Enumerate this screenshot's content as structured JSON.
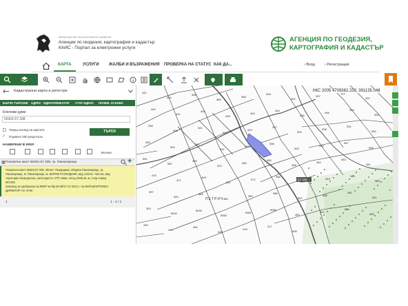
{
  "header": {
    "left_lines": [
      "Министерство на регионалното развитие",
      "Агенция по геодезия, картография и кадастър",
      "КАИС - Портал за електронни услуги"
    ],
    "right_lines": [
      "АГЕНЦИЯ ПО ГЕОДЕЗИЯ,",
      "КАРТОГРАФИЯ И КАДАСТЪР"
    ]
  },
  "nav": {
    "items": [
      "КАРТА",
      "УСЛУГИ",
      "ЖАЛБИ И ВЪЗРАЖЕНИЯ",
      "ПРОВЕРКА НА СТАТУС",
      "КАК ДА..."
    ],
    "login": "Вход",
    "register": "Регистрация"
  },
  "map": {
    "coord": "ККС 2005 4709382.239, 391135.046",
    "labels": [
      "331",
      "394",
      "396",
      "389",
      "395",
      "318",
      "391",
      "397",
      "333",
      "402",
      "440",
      "441",
      "442",
      "445",
      "443",
      "444",
      "446",
      "448",
      "449",
      "390",
      "338",
      "326",
      "321",
      "312",
      "319",
      "337",
      "329",
      "328",
      "331",
      "530",
      "535",
      "534",
      "531",
      "532",
      "539",
      "538",
      "533",
      "543",
      "547",
      "548",
      "551",
      "552",
      "329",
      "322",
      "456",
      "455",
      "458",
      "452",
      "353",
      "451",
      "476",
      "471",
      "493",
      "361",
      "372",
      "366",
      "347",
      "349",
      "344",
      "365",
      "357",
      "393",
      "364",
      "360",
      "363",
      "388",
      "367",
      "348",
      "340",
      "341",
      "343",
      "5042",
      "5040",
      "5063",
      "5061",
      "5064",
      "480",
      "422",
      "500",
      "452",
      "439",
      "449",
      "484",
      "409",
      "418",
      "417",
      "406"
    ],
    "mark": "57.338",
    "street": "ПЕТРИЧ"
  },
  "panel": {
    "title": "Кадастрална карта и регистри",
    "tabs": [
      "БЪРЗО ТЪРСЕНЕ",
      "АДРЕС",
      "ИДЕНТИФИКАТОР",
      "СТАР ИДЕНТ.",
      "ПОЗЕМ. ОСНОВА"
    ],
    "key_label": "Ключови думи",
    "key_value": "55302.57.338",
    "check1": "Текущ изглед на картата",
    "check2": "Първите 200 резултата",
    "search_btn": "ТЪРСИ",
    "found_header": "НАМЕРЕНИ В КККР",
    "all_label": "Всички",
    "result_header": "Поземлен имот 55302.57.338, гр. Панагюрище",
    "result_lines": [
      "Поземлен имот 55302.57.338, област Пазарджик, община Панагюрище, гр.",
      "Панагюрище, м. Панагюрище, м. БОРОВ РАЗХОДНИК, вид собств. Частна, вид",
      "територия Земеделска, категория 8, НТП Нива, площ 2946 кв. м, стар номер",
      "057338",
      "Заповед за одобрение на КККР № РД-18-39/17.07.2012 г. на ИЗПЪЛНИТЕЛЕН",
      "ДИРЕКТОР НА АГКК"
    ],
    "page": "1",
    "page_range": "1 - 1 / 1"
  }
}
